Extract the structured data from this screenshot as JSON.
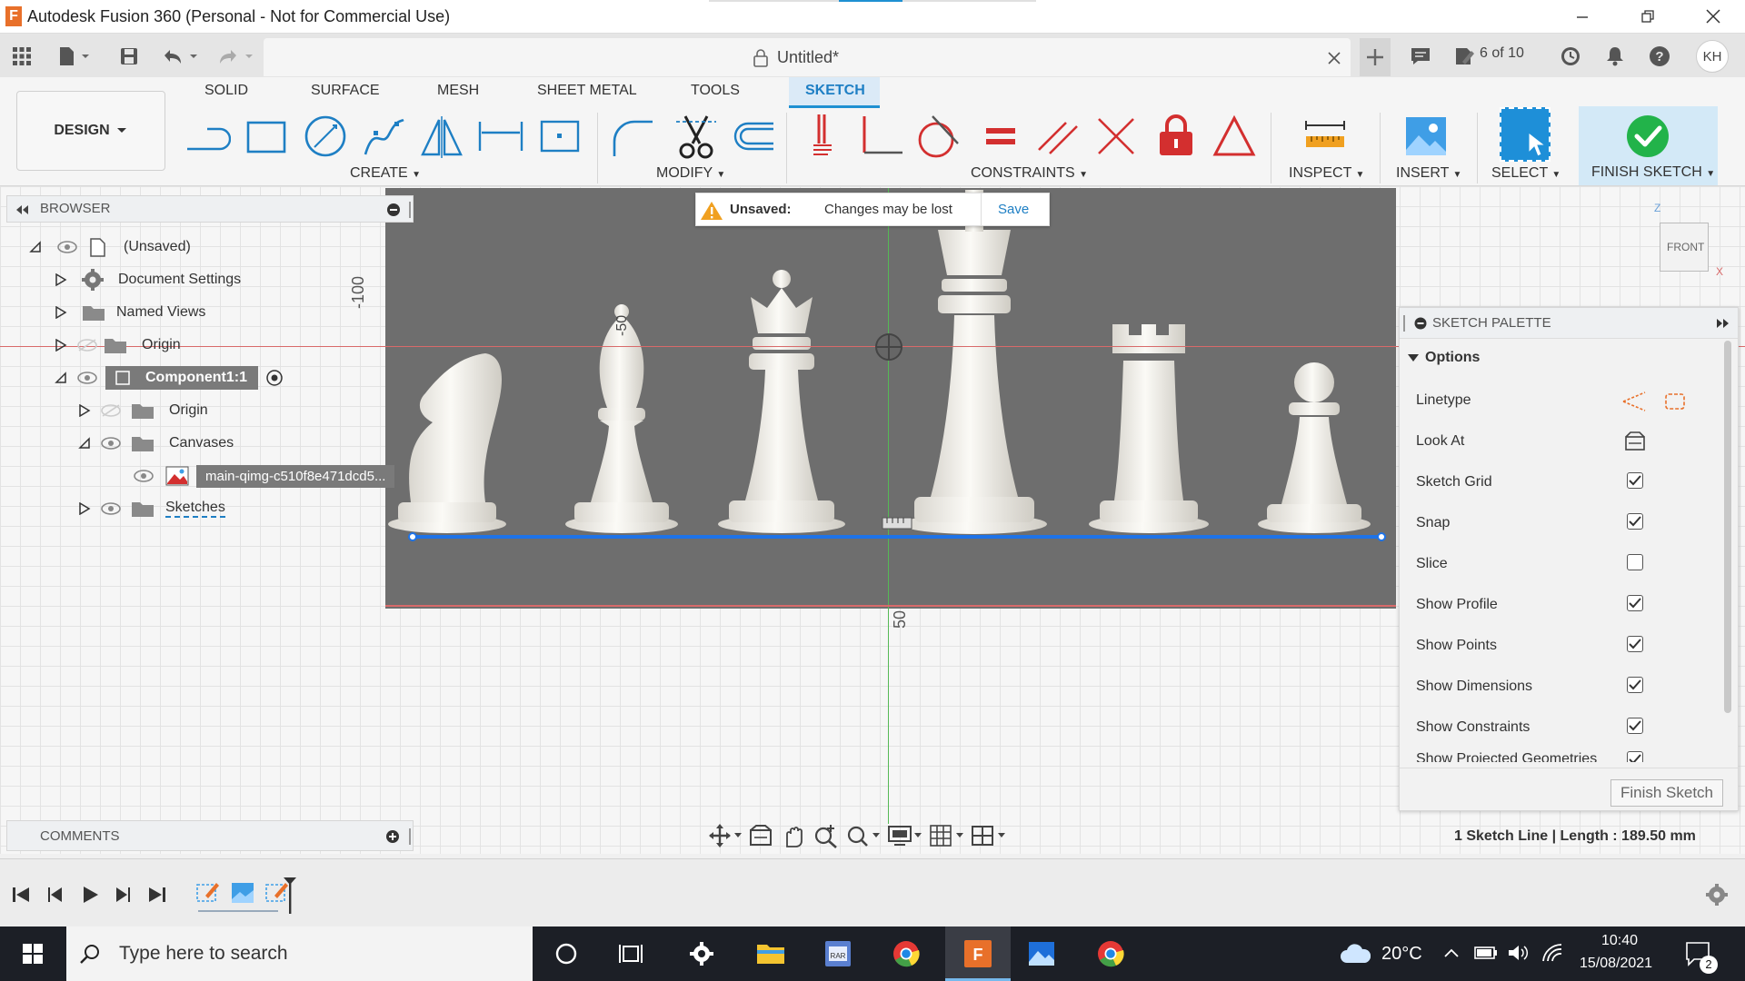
{
  "window": {
    "title": "Autodesk Fusion 360 (Personal - Not for Commercial Use)",
    "app_logo_letter": "F"
  },
  "appbar": {
    "doc_title": "Untitled*",
    "job_status": "6 of 10",
    "user_initials": "KH"
  },
  "ribbon": {
    "workspace": "DESIGN",
    "tabs": [
      "SOLID",
      "SURFACE",
      "MESH",
      "SHEET METAL",
      "TOOLS",
      "SKETCH"
    ],
    "active_tab": "SKETCH",
    "groups": [
      "CREATE",
      "MODIFY",
      "CONSTRAINTS",
      "INSPECT",
      "INSERT",
      "SELECT",
      "FINISH SKETCH"
    ]
  },
  "notice": {
    "status": "Unsaved:",
    "message": "Changes may be lost",
    "action": "Save"
  },
  "browser": {
    "title": "BROWSER",
    "items": [
      {
        "label": "(Unsaved)"
      },
      {
        "label": "Document Settings"
      },
      {
        "label": "Named Views"
      },
      {
        "label": "Origin"
      },
      {
        "label": "Component1:1"
      },
      {
        "label": "Origin"
      },
      {
        "label": "Canvases"
      },
      {
        "label": "main-qimg-c510f8e471dcd5..."
      },
      {
        "label": "Sketches"
      }
    ]
  },
  "viewport": {
    "dim_upper": "-100",
    "dim_piece": "-50",
    "dim_lower": "50",
    "viewcube_face": "FRONT",
    "axis_z": "Z",
    "axis_x": "X"
  },
  "palette": {
    "title": "SKETCH PALETTE",
    "section": "Options",
    "rows": [
      {
        "label": "Linetype"
      },
      {
        "label": "Look At"
      },
      {
        "label": "Sketch Grid",
        "checked": true
      },
      {
        "label": "Snap",
        "checked": true
      },
      {
        "label": "Slice",
        "checked": false
      },
      {
        "label": "Show Profile",
        "checked": true
      },
      {
        "label": "Show Points",
        "checked": true
      },
      {
        "label": "Show Dimensions",
        "checked": true
      },
      {
        "label": "Show Constraints",
        "checked": true
      },
      {
        "label": "Show Projected Geometries",
        "checked": true
      }
    ],
    "finish_button": "Finish Sketch"
  },
  "comments": {
    "title": "COMMENTS"
  },
  "status": {
    "text": "1 Sketch Line | Length : 189.50 mm"
  },
  "taskbar": {
    "search_placeholder": "Type here to search",
    "weather": "20°C",
    "time": "10:40",
    "date": "15/08/2021",
    "notification_count": "2"
  },
  "colors": {
    "accent": "#1e90d2",
    "canvas_bg": "#6e6e6e",
    "sketch_line": "#1e73e8",
    "finish_green": "#22b34a",
    "warning": "#f0a020"
  }
}
